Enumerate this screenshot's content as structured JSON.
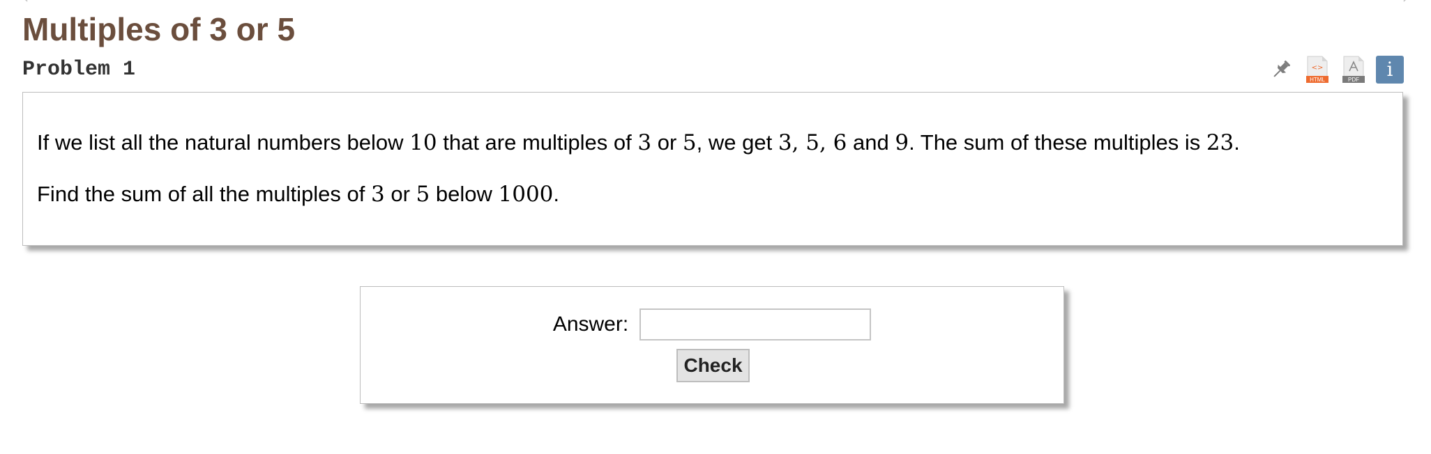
{
  "header": {
    "title": "Multiples of 3 or 5",
    "problem_label": "Problem 1"
  },
  "toolbar": {
    "icons": [
      "pin-icon",
      "html-file-icon",
      "pdf-file-icon",
      "info-icon"
    ],
    "html_badge": "HTML",
    "pdf_badge": "PDF",
    "info_glyph": "i",
    "colors": {
      "html_badge": "#ee6b2f",
      "pdf_badge": "#7a7a7a",
      "info_button": "#5f87ae",
      "pin": "#7d7d7d"
    }
  },
  "problem": {
    "p1": {
      "t1": "If we list all the natural numbers below ",
      "m1": "10",
      "t2": " that are multiples of ",
      "m2": "3",
      "t3": " or ",
      "m3": "5",
      "t4": ", we get ",
      "m4": "3, 5, 6",
      "t5": " and ",
      "m5": "9",
      "t6": ". The sum of these multiples is ",
      "m6": "23",
      "t7": "."
    },
    "p2": {
      "t1": "Find the sum of all the multiples of ",
      "m1": "3",
      "t2": " or ",
      "m2": "5",
      "t3": " below ",
      "m3": "1000",
      "t4": "."
    }
  },
  "answer_form": {
    "label": "Answer:",
    "value": "",
    "check_label": "Check"
  },
  "colors": {
    "title": "#6b4e3d",
    "problem_heading": "#333333",
    "box_border": "#bdbdbd",
    "button_bg": "#e3e3e3"
  }
}
